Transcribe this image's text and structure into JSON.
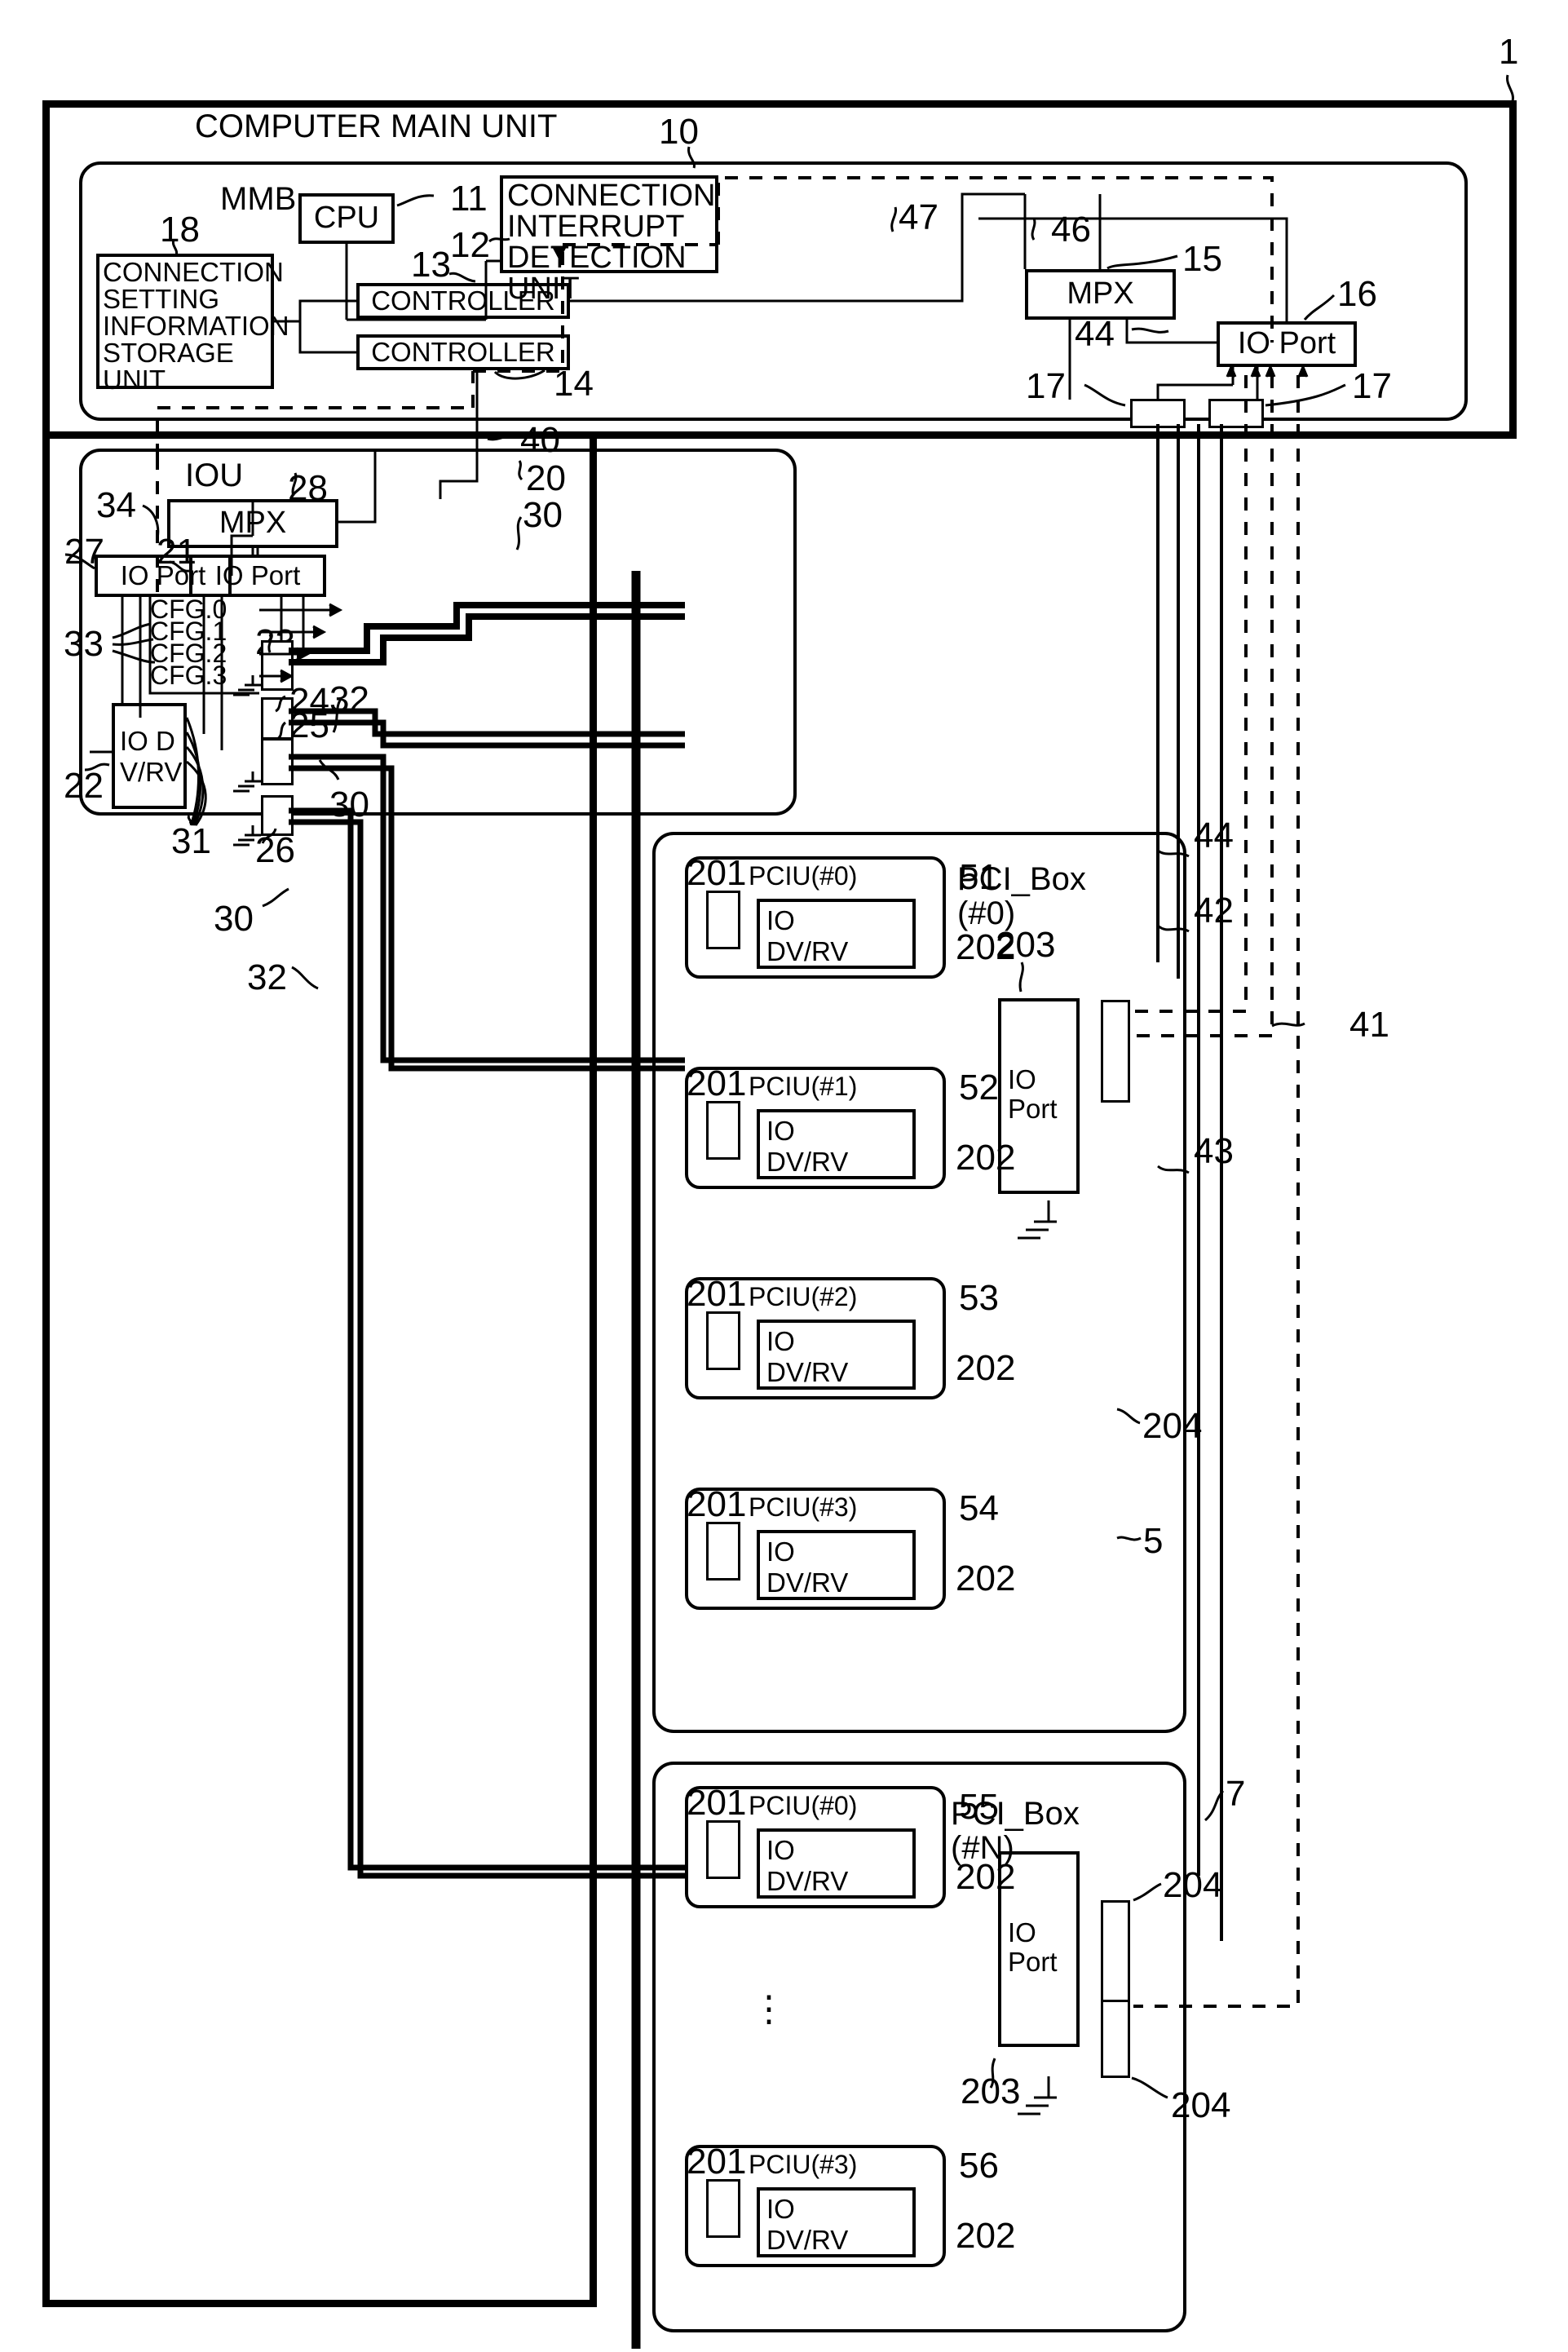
{
  "figure": {
    "outer_label": "1",
    "main_unit_title": "COMPUTER MAIN UNIT",
    "main_unit_ref": "10"
  },
  "mmb": {
    "title": "MMB",
    "cpu": {
      "label": "CPU",
      "ref": "11"
    },
    "interrupt_unit": {
      "label": "CONNECTION\nINTERRUPT\nDETECTION\nUNIT",
      "ref": "12"
    },
    "storage_unit": {
      "label": "CONNECTION\nSETTING\nINFORMATION\nSTORAGE\nUNIT",
      "ref": "18"
    },
    "controller_1": {
      "label": "CONTROLLER",
      "ref": "13"
    },
    "controller_2": {
      "label": "CONTROLLER",
      "ref": "14"
    },
    "mpx": {
      "label": "MPX",
      "ref": "15"
    },
    "io_port": {
      "label": "IO Port",
      "ref": "16"
    },
    "connector_left_ref": "17",
    "connector_right_ref": "17",
    "bus_46": "46",
    "bus_47": "47",
    "bus_44": "44"
  },
  "iou": {
    "title": "IOU",
    "ref": "20",
    "mpx": {
      "label": "MPX",
      "ref": "28"
    },
    "io_port_left": {
      "label": "IO Port",
      "ref": "27"
    },
    "io_port_right": {
      "label": "IO Port",
      "ref": "21"
    },
    "io_dv_rv": {
      "label": "IO D\nV/RV",
      "ref": "22"
    },
    "cfg_rows": [
      "CFG.0",
      "CFG.1",
      "CFG.2",
      "CFG.3"
    ],
    "cfg_ref": "33",
    "refs": {
      "dashed_boundary": "34",
      "bus_40": "40",
      "cable_30_top": "30",
      "switch_23": "23",
      "switch_24": "24",
      "switch_25": "25",
      "switch_26": "26",
      "leads_31": "31",
      "cable_32": "32",
      "cable_30_mid": "30",
      "cable_30_bottom": "30",
      "cable_32_bottom": "32"
    }
  },
  "pci_box_0": {
    "title": "PCI_Box\n(#0)",
    "ref": "5",
    "io_port": {
      "label": "IO\nPort",
      "ref": "203"
    },
    "connector_ref": "204",
    "units": [
      {
        "label": "PCIU(#0)",
        "card": "IO\nDV/RV",
        "ref_unit": "201",
        "ref_card": "202",
        "ref_slot": "51"
      },
      {
        "label": "PCIU(#1)",
        "card": "IO\nDV/RV",
        "ref_unit": "201",
        "ref_card": "202",
        "ref_slot": "52"
      },
      {
        "label": "PCIU(#2)",
        "card": "IO\nDV/RV",
        "ref_unit": "201",
        "ref_card": "202",
        "ref_slot": "53"
      },
      {
        "label": "PCIU(#3)",
        "card": "IO\nDV/RV",
        "ref_unit": "201",
        "ref_card": "202",
        "ref_slot": "54"
      }
    ]
  },
  "pci_box_n": {
    "title": "PCI_Box\n(#N)",
    "ref": "7",
    "io_port": {
      "label": "IO\nPort",
      "ref": "203"
    },
    "connector_ref_top": "204",
    "connector_ref_bottom": "204",
    "ellipsis": "⋮",
    "units": [
      {
        "label": "PCIU(#0)",
        "card": "IO\nDV/RV",
        "ref_unit": "201",
        "ref_card": "202",
        "ref_slot": "55"
      },
      {
        "label": "PCIU(#3)",
        "card": "IO\nDV/RV",
        "ref_unit": "201",
        "ref_card": "202",
        "ref_slot": "56"
      }
    ]
  },
  "cable_refs": {
    "c41": "41",
    "c42": "42",
    "c43": "43",
    "c44": "44"
  }
}
